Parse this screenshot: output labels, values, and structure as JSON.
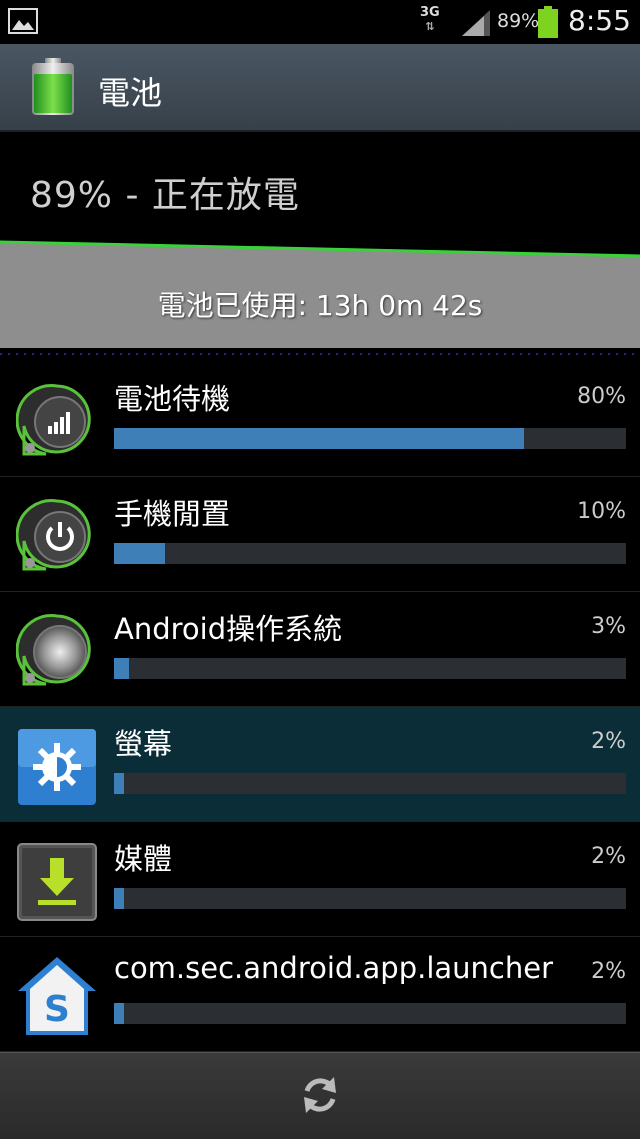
{
  "status_bar": {
    "network": "3G",
    "battery_pct": "89%",
    "time": "8:55",
    "left_icon": "image-icon"
  },
  "titlebar": {
    "title": "電池"
  },
  "battery_status": "89% - 正在放電",
  "battery_used": "電池已使用: 13h 0m 42s",
  "items": [
    {
      "name": "電池待機",
      "pct": "80%",
      "value": 0.8,
      "icon": "signal-bars-icon"
    },
    {
      "name": "手機閒置",
      "pct": "10%",
      "value": 0.1,
      "icon": "power-icon"
    },
    {
      "name": "Android操作系統",
      "pct": "3%",
      "value": 0.03,
      "icon": "android-os-icon"
    },
    {
      "name": "螢幕",
      "pct": "2%",
      "value": 0.02,
      "icon": "brightness-icon"
    },
    {
      "name": "媒體",
      "pct": "2%",
      "value": 0.02,
      "icon": "download-icon"
    },
    {
      "name": "com.sec.android.app.launcher",
      "pct": "2%",
      "value": 0.02,
      "icon": "launcher-home-icon"
    }
  ],
  "colors": {
    "bar_fill": "#3d7fb6",
    "bar_track": "#2b2f33",
    "highlight_row": "#0a2d38",
    "graph_line": "#3ad13a"
  },
  "bottom": {
    "refresh_icon": "refresh-icon"
  }
}
